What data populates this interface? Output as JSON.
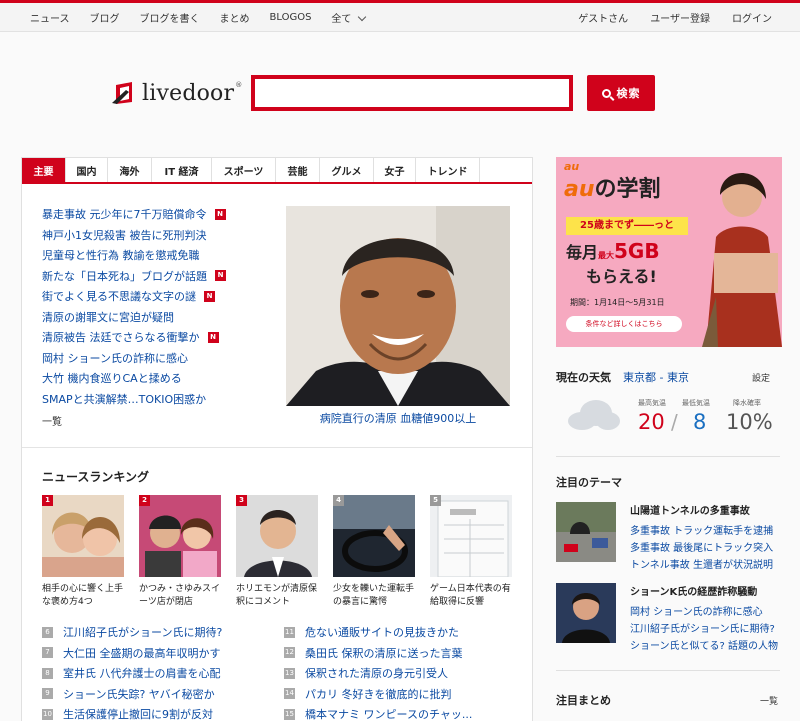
{
  "topnav": {
    "left": [
      "ニュース",
      "ブログ",
      "ブログを書く",
      "まとめ",
      "BLOGOS",
      "全て"
    ],
    "right": [
      "ゲストさん",
      "ユーザー登録",
      "ログイン"
    ]
  },
  "header": {
    "logo_text": "livedoor",
    "logo_reg": "®",
    "search_value": "",
    "search_button": "検索"
  },
  "tabs": [
    "主要",
    "国内",
    "海外",
    "IT 経済",
    "スポーツ",
    "芸能",
    "グルメ",
    "女子",
    "トレンド"
  ],
  "headlines": [
    {
      "text": "暴走事故 元少年に7千万賠償命令",
      "new": true
    },
    {
      "text": "神戸小1女児殺害 被告に死刑判決",
      "new": false
    },
    {
      "text": "児童母と性行為 教諭を懲戒免職",
      "new": false
    },
    {
      "text": "新たな「日本死ね」ブログが話題",
      "new": true
    },
    {
      "text": "街でよく見る不思議な文字の謎",
      "new": true
    },
    {
      "text": "清原の謝罪文に宮迫が疑問",
      "new": false
    },
    {
      "text": "清原被告 法廷でさらなる衝撃か",
      "new": true
    },
    {
      "text": "岡村 ショーン氏の詐称に感心",
      "new": false
    },
    {
      "text": "大竹 機内食巡りCAと揉める",
      "new": false
    },
    {
      "text": "SMAPと共演解禁…TOKIO困惑か",
      "new": false
    }
  ],
  "headlines_more": "一覧",
  "new_badge": "N",
  "photo_caption": "病院直行の清原 血糖値900以上",
  "ranking": {
    "title": "ニュースランキング",
    "cards": [
      {
        "num": "1",
        "caption": "相手の心に響く上手な褒め方4つ",
        "badge_color": "#d0021b"
      },
      {
        "num": "2",
        "caption": "かつみ・さゆみスイーツ店が閉店",
        "badge_color": "#d0021b"
      },
      {
        "num": "3",
        "caption": "ホリエモンが清原保釈にコメント",
        "badge_color": "#d0021b"
      },
      {
        "num": "4",
        "caption": "少女を轢いた運転手の暴言に驚愕",
        "badge_color": "#999999"
      },
      {
        "num": "5",
        "caption": "ゲーム日本代表の有給取得に反響",
        "badge_color": "#999999"
      }
    ],
    "list_left": [
      {
        "num": "6",
        "text": "江川紹子氏がショーン氏に期待?"
      },
      {
        "num": "7",
        "text": "大仁田 全盛期の最高年収明かす"
      },
      {
        "num": "8",
        "text": "室井氏 八代弁護士の肩書を心配"
      },
      {
        "num": "9",
        "text": "ショーン氏失踪? ヤバイ秘密か"
      },
      {
        "num": "10",
        "text": "生活保護停止撤回に9割が反対"
      }
    ],
    "list_right": [
      {
        "num": "11",
        "text": "危ない通販サイトの見抜きかた"
      },
      {
        "num": "12",
        "text": "桑田氏 保釈の清原に送った言葉"
      },
      {
        "num": "13",
        "text": "保釈された清原の身元引受人"
      },
      {
        "num": "14",
        "text": "パカリ 冬好きを徹底的に批判"
      },
      {
        "num": "15",
        "text": "橋本マナミ ワンピースのチャッ..."
      }
    ]
  },
  "ad": {
    "brand": "au",
    "title_part": "の学割",
    "title_brand": "au",
    "banner": "25歳までず――っと",
    "line1": "毎月",
    "line1_small": "最大",
    "line1_big": "5GB",
    "line2": "もらえる!",
    "period": "期間：1月14日～5月31日",
    "cta": "条件など詳しくはこちら"
  },
  "weather": {
    "title": "現在の天気",
    "location": "東京都 - 東京",
    "settings": "設定",
    "max_label": "最高気温",
    "min_label": "最低気温",
    "rain_label": "降水確率",
    "max": "20",
    "min": "8",
    "rain": "10%",
    "max_color": "#d0021b",
    "min_color": "#1a6fc1",
    "slash": "/"
  },
  "themes": {
    "title": "注目のテーマ",
    "items": [
      {
        "title": "山陽道トンネルの多重事故",
        "links": [
          "多重事故 トラック運転手を逮捕",
          "多重事故 最後尾にトラック突入",
          "トンネル事故 生還者が状況説明"
        ]
      },
      {
        "title": "ショーンK氏の経歴詐称騒動",
        "links": [
          "岡村 ショーン氏の詐称に感心",
          "江川紹子氏がショーン氏に期待?",
          "ショーン氏と似てる? 話題の人物"
        ]
      }
    ]
  },
  "matome": {
    "title": "注目まとめ",
    "more": "一覧"
  }
}
